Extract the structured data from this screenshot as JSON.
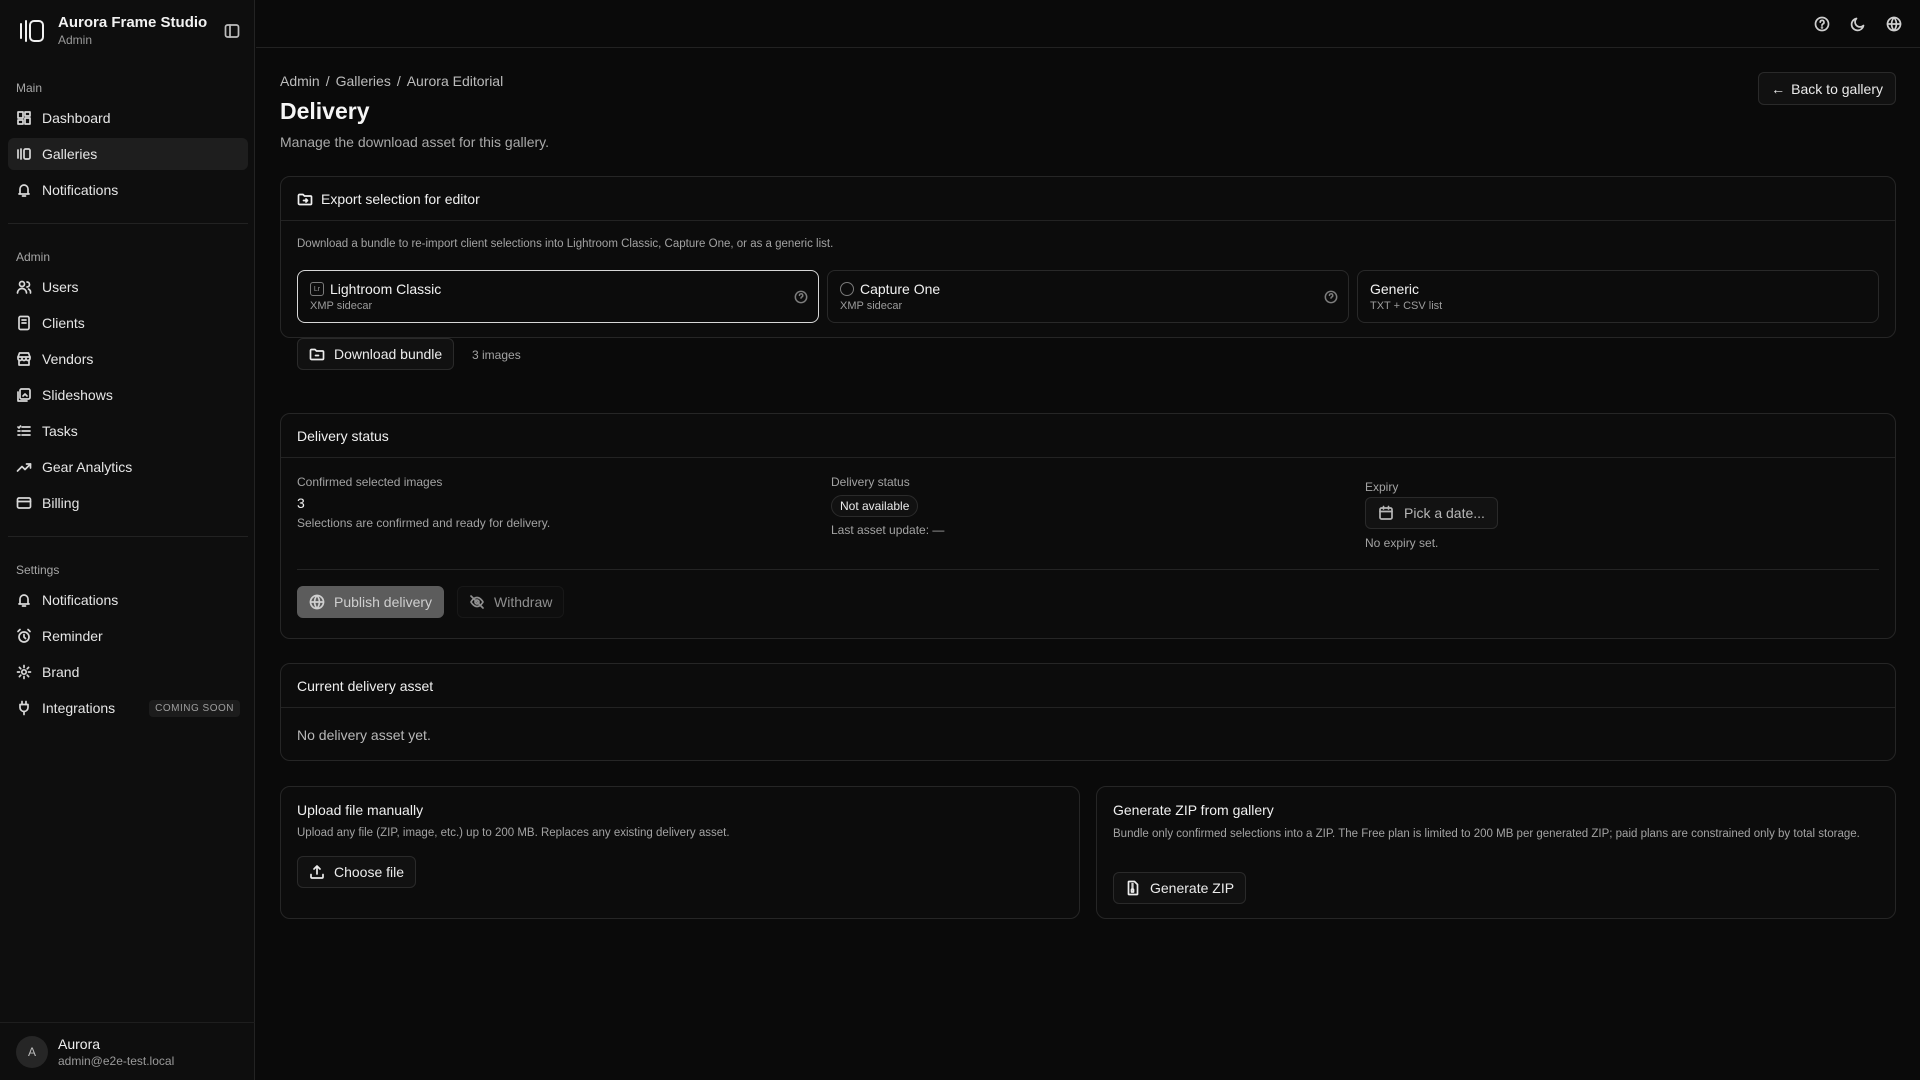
{
  "app": {
    "name": "Aurora Frame Studio",
    "role": "Admin"
  },
  "sidebar": {
    "main_heading": "Main",
    "main_items": [
      {
        "label": "Dashboard",
        "icon": "dashboard-icon"
      },
      {
        "label": "Galleries",
        "icon": "galleries-icon"
      },
      {
        "label": "Notifications",
        "icon": "bell-icon"
      }
    ],
    "admin_heading": "Admin",
    "admin_items": [
      {
        "label": "Users",
        "icon": "users-icon"
      },
      {
        "label": "Clients",
        "icon": "clients-icon"
      },
      {
        "label": "Vendors",
        "icon": "store-icon"
      },
      {
        "label": "Slideshows",
        "icon": "slideshow-icon"
      },
      {
        "label": "Tasks",
        "icon": "list-icon"
      },
      {
        "label": "Gear Analytics",
        "icon": "trend-icon"
      },
      {
        "label": "Billing",
        "icon": "card-icon"
      }
    ],
    "settings_heading": "Settings",
    "settings_items": [
      {
        "label": "Notifications",
        "icon": "bell-icon"
      },
      {
        "label": "Reminder",
        "icon": "alarm-icon"
      },
      {
        "label": "Brand",
        "icon": "gear-icon"
      },
      {
        "label": "Integrations",
        "icon": "plug-icon",
        "badge": "COMING SOON"
      }
    ]
  },
  "user": {
    "initial": "A",
    "name": "Aurora",
    "email": "admin@e2e-test.local"
  },
  "breadcrumb": [
    "Admin",
    "Galleries",
    "Aurora Editorial"
  ],
  "page": {
    "title": "Delivery",
    "description": "Manage the download asset for this gallery.",
    "back_label": "Back to gallery"
  },
  "export": {
    "title": "Export selection for editor",
    "description": "Download a bundle to re-import client selections into Lightroom Classic, Capture One, or as a generic list.",
    "options": [
      {
        "title": "Lightroom Classic",
        "sub": "XMP sidecar"
      },
      {
        "title": "Capture One",
        "sub": "XMP sidecar"
      },
      {
        "title": "Generic",
        "sub": "TXT + CSV list"
      }
    ],
    "download_label": "Download bundle",
    "count_label": "3 images"
  },
  "status": {
    "title": "Delivery status",
    "confirmed_label": "Confirmed selected images",
    "confirmed_value": "3",
    "confirmed_note": "Selections are confirmed and ready for delivery.",
    "delivery_label": "Delivery status",
    "delivery_badge": "Not available",
    "last_update": "Last asset update: —",
    "expiry_label": "Expiry",
    "expiry_placeholder": "Pick a date...",
    "expiry_note": "No expiry set.",
    "publish_label": "Publish delivery",
    "withdraw_label": "Withdraw"
  },
  "current": {
    "title": "Current delivery asset",
    "empty": "No delivery asset yet."
  },
  "upload": {
    "title": "Upload file manually",
    "description": "Upload any file (ZIP, image, etc.) up to 200 MB. Replaces any existing delivery asset.",
    "button": "Choose file"
  },
  "zip": {
    "title": "Generate ZIP from gallery",
    "description": "Bundle only confirmed selections into a ZIP. The Free plan is limited to 200 MB per generated ZIP; paid plans are constrained only by total storage.",
    "button": "Generate ZIP"
  }
}
